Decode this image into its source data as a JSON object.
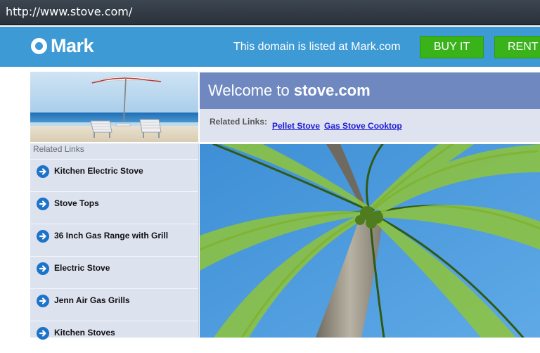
{
  "browser": {
    "url": "http://www.stove.com/"
  },
  "header": {
    "logo_text": "Mark",
    "listed_text": "This domain is listed at Mark.com",
    "buy_label": "BUY IT",
    "rent_label": "RENT"
  },
  "welcome": {
    "prefix": "Welcome to ",
    "domain": "stove.com"
  },
  "related_strip": {
    "label": "Related Links:",
    "links": [
      "Pellet Stove",
      "Gas Stove Cooktop"
    ]
  },
  "sidebar": {
    "heading": "Related Links",
    "items": [
      {
        "label": "Kitchen Electric Stove"
      },
      {
        "label": "Stove Tops"
      },
      {
        "label": "36 Inch Gas Range with Grill"
      },
      {
        "label": "Electric Stove"
      },
      {
        "label": "Jenn Air Gas Grills"
      },
      {
        "label": "Kitchen Stoves"
      }
    ]
  },
  "colors": {
    "topbar": "#3d9ad5",
    "button_green": "#3ab21a",
    "welcome_bg": "#6f89c0",
    "sidebar_bg": "#dde2ef",
    "arrow_icon": "#1d73c8",
    "link": "#1a1ad6"
  },
  "icons": {
    "logo": "ring-logo-icon",
    "sidebar_bullet": "arrow-right-circle-icon"
  }
}
